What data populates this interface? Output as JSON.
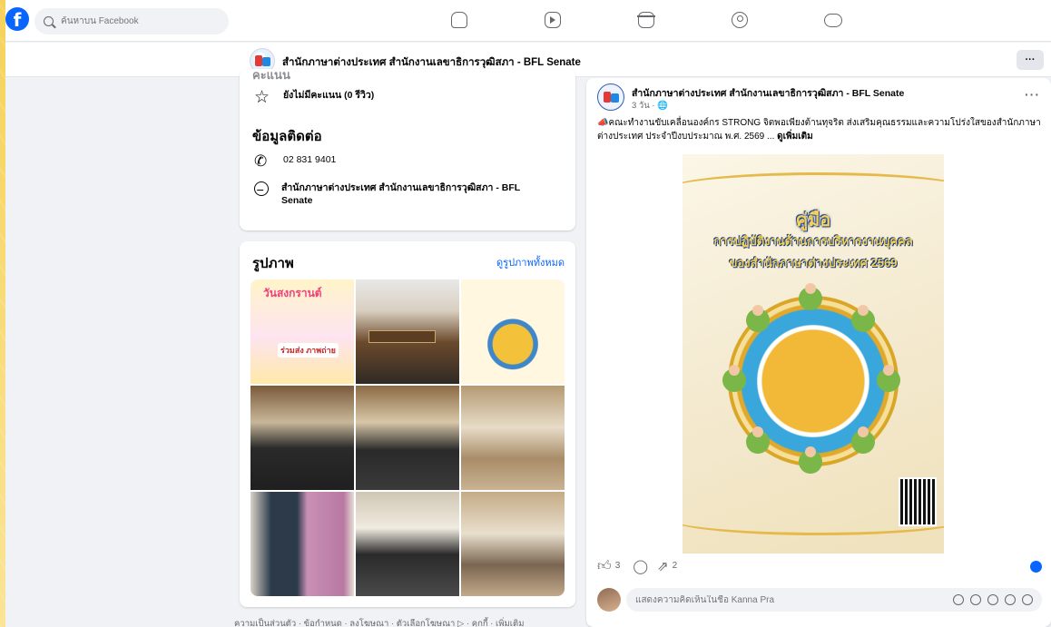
{
  "search": {
    "placeholder": "ค้นหาบน Facebook"
  },
  "nav": {
    "icons": [
      "home-icon",
      "video-icon",
      "marketplace-icon",
      "groups-icon",
      "gaming-icon"
    ]
  },
  "page": {
    "name": "สำนักภาษาต่างประเทศ สำนักงานเลขาธิการวุฒิสภา - BFL Senate",
    "more_label": "···"
  },
  "intro": {
    "clipped_heading": "คะแนน",
    "rating": "ยังไม่มีคะแนน (0 รีวิว)"
  },
  "contact": {
    "title": "ข้อมูลติดต่อ",
    "phone": "02 831 9401",
    "messenger": "สำนักภาษาต่างประเทศ สำนักงานเลขาธิการวุฒิสภา - BFL Senate"
  },
  "photos": {
    "title": "รูปภาพ",
    "see_all": "ดูรูปภาพทั้งหมด",
    "tile1_title": "วันสงกรานต์",
    "tile1_badge": "ร่วมส่ง ภาพถ่าย"
  },
  "footer": "ความเป็นส่วนตัว · ข้อกำหนด · ลงโฆษณา · ตัวเลือกโฆษณา ▷ · คุกกี้ · เพิ่มเติม",
  "post": {
    "author": "สำนักภาษาต่างประเทศ สำนักงานเลขาธิการวุฒิสภา - BFL Senate",
    "meta": "3 วัน · 🌐",
    "text": "📣คณะทำงานขับเคลื่อนองค์กร STRONG จิตพอเพียงต้านทุจริต ส่งเสริมคุณธรรมและความโปร่งใสของสำนักภาษาต่างประเทศ ประจำปีงบประมาณ พ.ศ. 2569 ...",
    "see_more": "ดูเพิ่มเติม",
    "image_title1": "คู่มือ",
    "image_title2": "การปฏิบัติงานด้านการบริหารงานบุคคล",
    "image_title3": "ของสำนักภาษาต่างประเทศ 2569",
    "likes": "3",
    "shares": "2",
    "comment_placeholder": "แสดงความคิดเห็นในชื่อ Kanna Pra"
  },
  "colors": {
    "accent": "#0866ff",
    "frame": "#f6d25a"
  }
}
